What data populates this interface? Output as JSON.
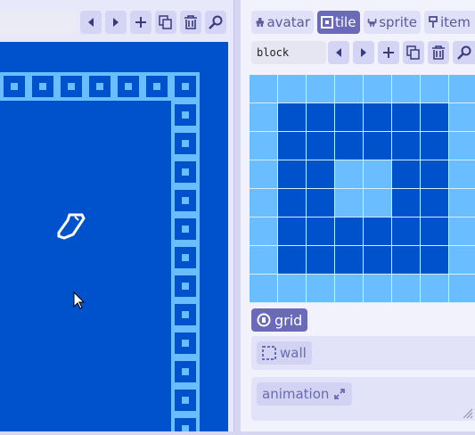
{
  "left_toolbar": {
    "buttons": [
      "prev-icon",
      "next-icon",
      "add-icon",
      "copy-icon",
      "delete-icon",
      "search-icon"
    ]
  },
  "room": {
    "background_color": "#0052cc",
    "border_tile_color": "#6abeff",
    "items": [
      "pencil-sprite",
      "mouse-cursor"
    ]
  },
  "tabs": {
    "avatar": "avatar",
    "tile": "tile",
    "sprite": "sprite",
    "item": "item"
  },
  "tile_editor": {
    "name": "block",
    "pixels": [
      [
        0,
        0,
        0,
        0,
        0,
        0,
        0,
        0
      ],
      [
        0,
        1,
        1,
        1,
        1,
        1,
        1,
        0
      ],
      [
        0,
        1,
        1,
        1,
        1,
        1,
        1,
        0
      ],
      [
        0,
        1,
        1,
        0,
        0,
        1,
        1,
        0
      ],
      [
        0,
        1,
        1,
        0,
        0,
        1,
        1,
        0
      ],
      [
        0,
        1,
        1,
        1,
        1,
        1,
        1,
        0
      ],
      [
        0,
        1,
        1,
        1,
        1,
        1,
        1,
        0
      ],
      [
        0,
        0,
        0,
        0,
        0,
        0,
        0,
        0
      ]
    ],
    "palette": {
      "background": "#6abeff",
      "tile": "#0052cc",
      "gridline": "#d8ecff"
    }
  },
  "grid_toggle": {
    "label": "grid"
  },
  "wall_toggle": {
    "label": "wall"
  },
  "animation_toggle": {
    "label": "animation"
  }
}
